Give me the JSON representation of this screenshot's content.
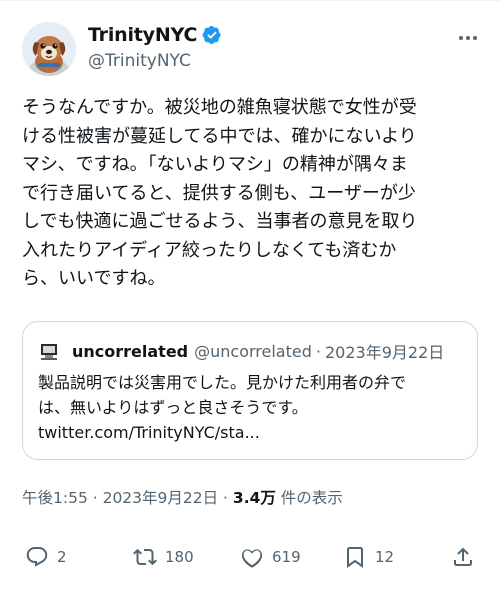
{
  "tweet": {
    "display_name": "TrinityNYC",
    "handle": "@TrinityNYC",
    "body": "そうなんですか。被災地の雑魚寝状態で女性が受\nける性被害が蔓延してる中では、確かにないより\nマシ、ですね。「ないよりマシ」の精神が隅々ま\nで行き届いてると、提供する側も、ユーザーが少\nしでも快適に過ごせるよう、当事者の意見を取り\n入れたりアイディア絞ったりしなくても済むか\nら、いいですね。",
    "timestamp": "午後1:55 · 2023年9月22日 · ",
    "views_count": "3.4万",
    "views_label": " 件の表示"
  },
  "quote": {
    "display_name": "uncorrelated",
    "handle": "@uncorrelated",
    "separator": "·",
    "date": "2023年9月22日",
    "body": "製品説明では災害用でした。見かけた利用者の弁で\nは、無いよりはずっと良さそうです。\ntwitter.com/TrinityNYC/sta..."
  },
  "actions": {
    "replies": "2",
    "retweets": "180",
    "likes": "619",
    "bookmarks": "12"
  },
  "icons": {
    "verified": "verified-badge-icon",
    "more": "more-icon",
    "reply": "reply-icon",
    "retweet": "retweet-icon",
    "like": "heart-icon",
    "bookmark": "bookmark-icon",
    "share": "share-icon"
  },
  "colors": {
    "text": "#0f1419",
    "secondary": "#536471",
    "verified": "#1d9bf0",
    "border": "#cfd9de"
  }
}
